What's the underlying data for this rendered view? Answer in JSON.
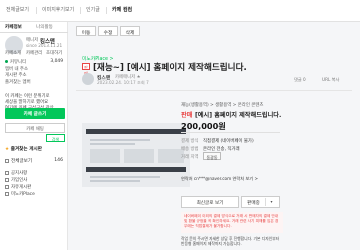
{
  "top_tabs": [
    {
      "label": "전체글보기",
      "active": false
    },
    {
      "label": "이미지후기보기",
      "active": false
    },
    {
      "label": "인기글",
      "active": false
    },
    {
      "label": "카페 컴컴",
      "active": true
    }
  ],
  "sidebar": {
    "tabs": [
      {
        "label": "카페정보",
        "active": true
      },
      {
        "label": "나의활동",
        "active": false
      }
    ],
    "rank": "매니저",
    "name": "킹스맨",
    "since": "since 2013.11.21",
    "links": [
      "카페소개",
      "카페관리",
      "초대하기",
      "관리"
    ],
    "invite_link": "카페관리",
    "stats": [
      {
        "label": "커뮤니티",
        "value": "3,049",
        "dot": true
      },
      {
        "label": "멤버 내 주소",
        "value": ""
      },
      {
        "label": "게시판 주소",
        "value": ""
      },
      {
        "label": "즐겨찾는 멤버",
        "value": ""
      }
    ],
    "join_text_1": "이 카페는 이런 분위기로",
    "join_text_2": "세상을 말하기로 했어요",
    "join_text_3": "여기에 카페 구석구석 감상",
    "write_button": "카페 글쓰기",
    "chat_button": "카페 채팅",
    "search_button": "검색",
    "favorites_label": "즐겨찾는 게시판",
    "all_posts_label": "전체글보기",
    "all_posts_count": "146",
    "menu": [
      "공지사항",
      "가입인사",
      "자유게시판",
      "미노카Place"
    ]
  },
  "toolbar": {
    "buttons": [
      "이동",
      "수정",
      "삭제"
    ]
  },
  "post": {
    "cafe_link": "미노카Place >",
    "badge": "판매",
    "title": "[재능~] [예시] 홈페이지 제작해드립니다.",
    "author": "킹스맨",
    "author_grade": "카페매니저 ★",
    "date": "2023.02.24. 10:17  조회 7",
    "reply_label": "댓글 0",
    "url_label": "URL 복사"
  },
  "product": {
    "breadcrumb": "재능(생활용역) > 생활용역 > 온라인 콘텐츠",
    "status": "판매",
    "name": "[예시] 홈페이지 제작해드립니다.",
    "price": "200,000원",
    "details": [
      {
        "key": "결제 방식",
        "value": "직접결제 (네이버페이 불가)"
      },
      {
        "key": "배송 방법",
        "value": "온라인 전송, 직거래"
      },
      {
        "key": "거래 지역",
        "value": "동광동"
      }
    ],
    "deal_button": "동광동",
    "contact": "연락처  cn***@naver.com  연락처 보기 >",
    "sort_button": "최신글로 보기",
    "pay_button": "판매중",
    "warning": "네이버페이 이외의 결제 방식으로 거래 시 판매자의 결제 안내 및 환불 규정을 꼭 확인하세요. 거래 관련 사기 피해를 입은 경우에는 직접결제가 불가합니다.",
    "description": "작업 문의 주시면 자세한 상담 후 진행합니다. 기본 디자인부터 반응형 홈페이지 제작까지 가능합니다."
  }
}
